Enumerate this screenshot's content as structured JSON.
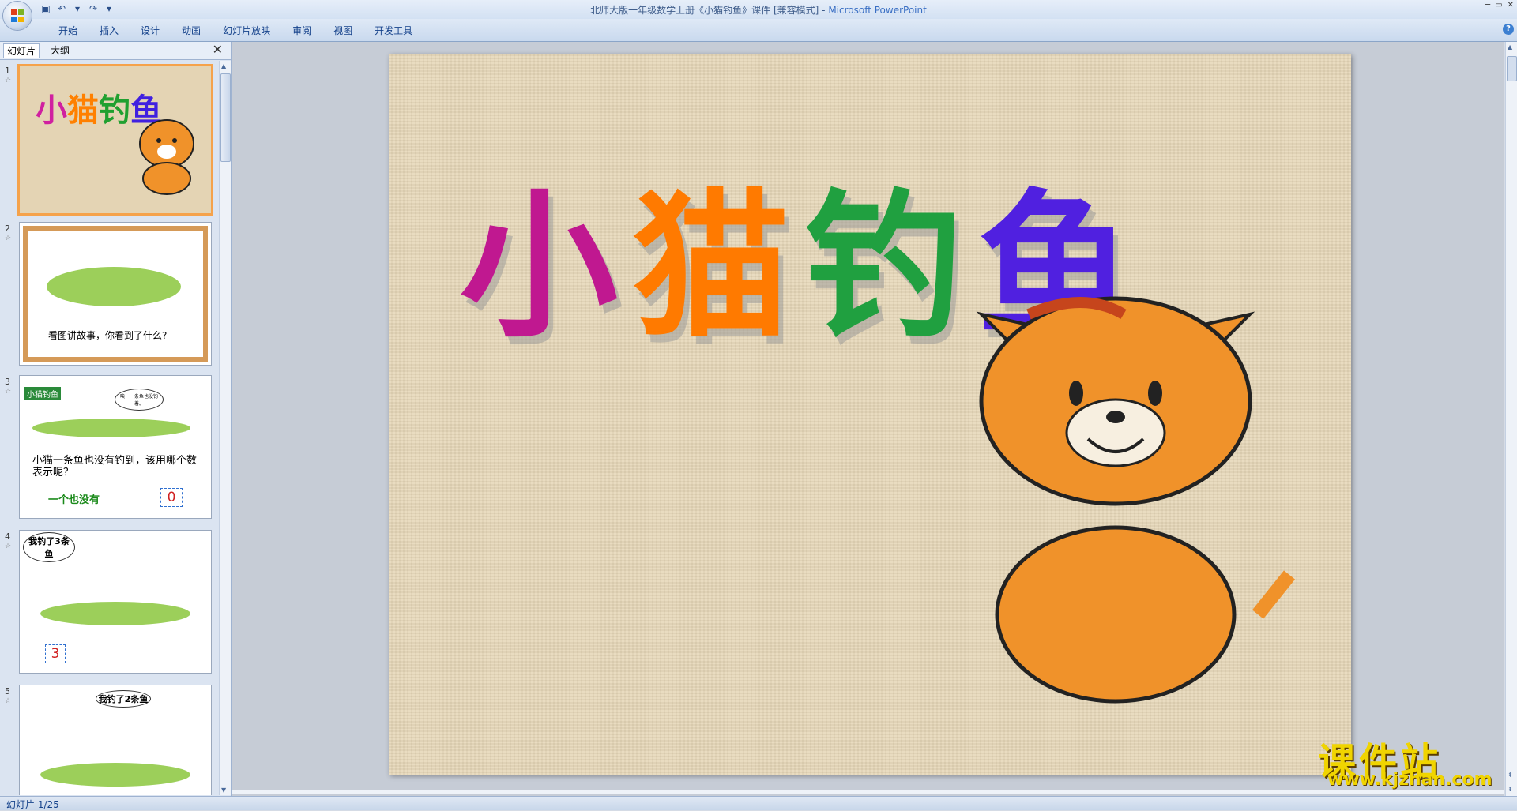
{
  "window": {
    "title": "北师大版一年级数学上册《小猫钓鱼》课件 [兼容模式]",
    "separator": " - ",
    "app_name": "Microsoft PowerPoint"
  },
  "ribbon": {
    "tabs": [
      "开始",
      "插入",
      "设计",
      "动画",
      "幻灯片放映",
      "审阅",
      "视图",
      "开发工具"
    ]
  },
  "panel": {
    "tab_slides": "幻灯片",
    "tab_outline": "大纲",
    "thumbnails": [
      {
        "num": "1",
        "title": "小猫钓鱼"
      },
      {
        "num": "2",
        "caption": "看图讲故事，你看到了什么?"
      },
      {
        "num": "3",
        "label": "小猫钓鱼",
        "bubble": "唉！一条鱼也没钓着。",
        "question": "小猫一条鱼也没有钓到，该用哪个数表示呢？",
        "answer_label": "一个也没有",
        "answer_digit": "0"
      },
      {
        "num": "4",
        "bubble": "我钓了3条鱼",
        "digit": "3"
      },
      {
        "num": "5",
        "bubble": "我钓了2条鱼"
      }
    ]
  },
  "slide": {
    "title_chars": [
      "小",
      "猫",
      "钓",
      "鱼"
    ]
  },
  "status": {
    "slide_info": "幻灯片 1/25"
  },
  "watermark": {
    "big": "课件站",
    "small": "www.kjzhan.com"
  },
  "colors": {
    "title_gradients": [
      "#c020c0",
      "#ff8000",
      "#20a030",
      "#4020e0"
    ],
    "selection_border": "#f5a24b"
  }
}
